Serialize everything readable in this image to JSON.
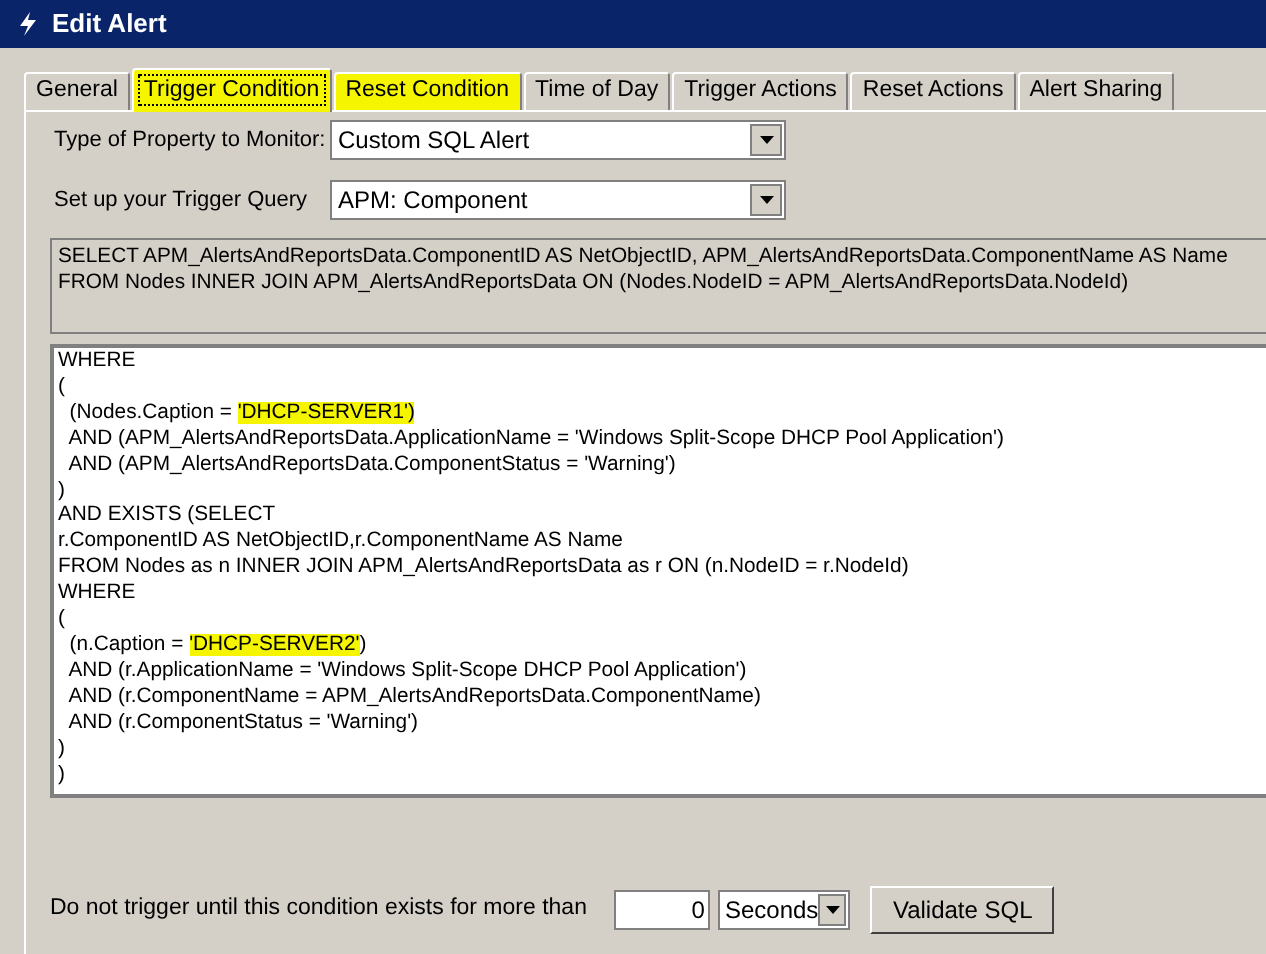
{
  "window": {
    "title": "Edit Alert"
  },
  "tabs": [
    {
      "label": "General",
      "selected": false,
      "highlighted": false
    },
    {
      "label": "Trigger Condition",
      "selected": true,
      "highlighted": true
    },
    {
      "label": "Reset Condition",
      "selected": false,
      "highlighted": true
    },
    {
      "label": "Time of Day",
      "selected": false,
      "highlighted": false
    },
    {
      "label": "Trigger Actions",
      "selected": false,
      "highlighted": false
    },
    {
      "label": "Reset Actions",
      "selected": false,
      "highlighted": false
    },
    {
      "label": "Alert Sharing",
      "selected": false,
      "highlighted": false
    }
  ],
  "property_type": {
    "label": "Type of Property to Monitor:",
    "value": "Custom SQL Alert"
  },
  "trigger_query": {
    "label": "Set up your Trigger Query",
    "value": "APM: Component"
  },
  "select_statement": [
    "SELECT APM_AlertsAndReportsData.ComponentID AS NetObjectID, APM_AlertsAndReportsData.ComponentName AS Name",
    "FROM Nodes INNER JOIN APM_AlertsAndReportsData ON (Nodes.NodeID = APM_AlertsAndReportsData.NodeId)"
  ],
  "where_clause": [
    [
      {
        "text": "WHERE",
        "highlighted": false
      }
    ],
    [
      {
        "text": "(",
        "highlighted": false
      }
    ],
    [
      {
        "text": "  (Nodes.Caption = ",
        "highlighted": false
      },
      {
        "text": "'DHCP-SERVER1')",
        "highlighted": true
      }
    ],
    [
      {
        "text": "  AND (APM_AlertsAndReportsData.ApplicationName = 'Windows Split-Scope DHCP Pool Application')",
        "highlighted": false
      }
    ],
    [
      {
        "text": "  AND (APM_AlertsAndReportsData.ComponentStatus = 'Warning')",
        "highlighted": false
      }
    ],
    [
      {
        "text": ")",
        "highlighted": false
      }
    ],
    [
      {
        "text": "AND EXISTS (SELECT",
        "highlighted": false
      }
    ],
    [
      {
        "text": "r.ComponentID AS NetObjectID,r.ComponentName AS Name",
        "highlighted": false
      }
    ],
    [
      {
        "text": "FROM Nodes as n INNER JOIN APM_AlertsAndReportsData as r ON (n.NodeID = r.NodeId)",
        "highlighted": false
      }
    ],
    [
      {
        "text": "WHERE",
        "highlighted": false
      }
    ],
    [
      {
        "text": "(",
        "highlighted": false
      }
    ],
    [
      {
        "text": "  (n.Caption = ",
        "highlighted": false
      },
      {
        "text": "'DHCP-SERVER2'",
        "highlighted": true
      },
      {
        "text": ")",
        "highlighted": false
      }
    ],
    [
      {
        "text": "  AND (r.ApplicationName = 'Windows Split-Scope DHCP Pool Application')",
        "highlighted": false
      }
    ],
    [
      {
        "text": "  AND (r.ComponentName = APM_AlertsAndReportsData.ComponentName)",
        "highlighted": false
      }
    ],
    [
      {
        "text": "  AND (r.ComponentStatus = 'Warning')",
        "highlighted": false
      }
    ],
    [
      {
        "text": ")",
        "highlighted": false
      }
    ],
    [
      {
        "text": ")",
        "highlighted": false
      }
    ]
  ],
  "duration": {
    "label": "Do not trigger until this condition exists for more than",
    "value": "0",
    "unit": "Seconds"
  },
  "buttons": [
    "Validate SQL"
  ]
}
